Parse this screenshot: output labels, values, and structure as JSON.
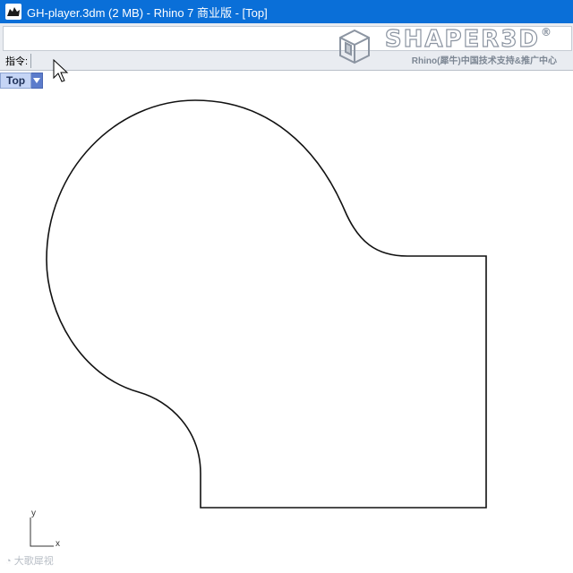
{
  "window": {
    "title": "GH-player.3dm (2 MB) - Rhino 7 商业版 - [Top]",
    "icon": "rhino-logo-icon",
    "background_color": "#0a6fd8"
  },
  "command": {
    "label": "指令:",
    "value": ""
  },
  "watermark": {
    "brand": "SHAPER3D",
    "registered": "®",
    "subtitle": "Rhino(犀牛)中国技术支持&推广中心"
  },
  "viewport": {
    "tab_label": "Top",
    "axis_x": "x",
    "axis_y": "y",
    "footer_mark": "大歌犀视"
  }
}
